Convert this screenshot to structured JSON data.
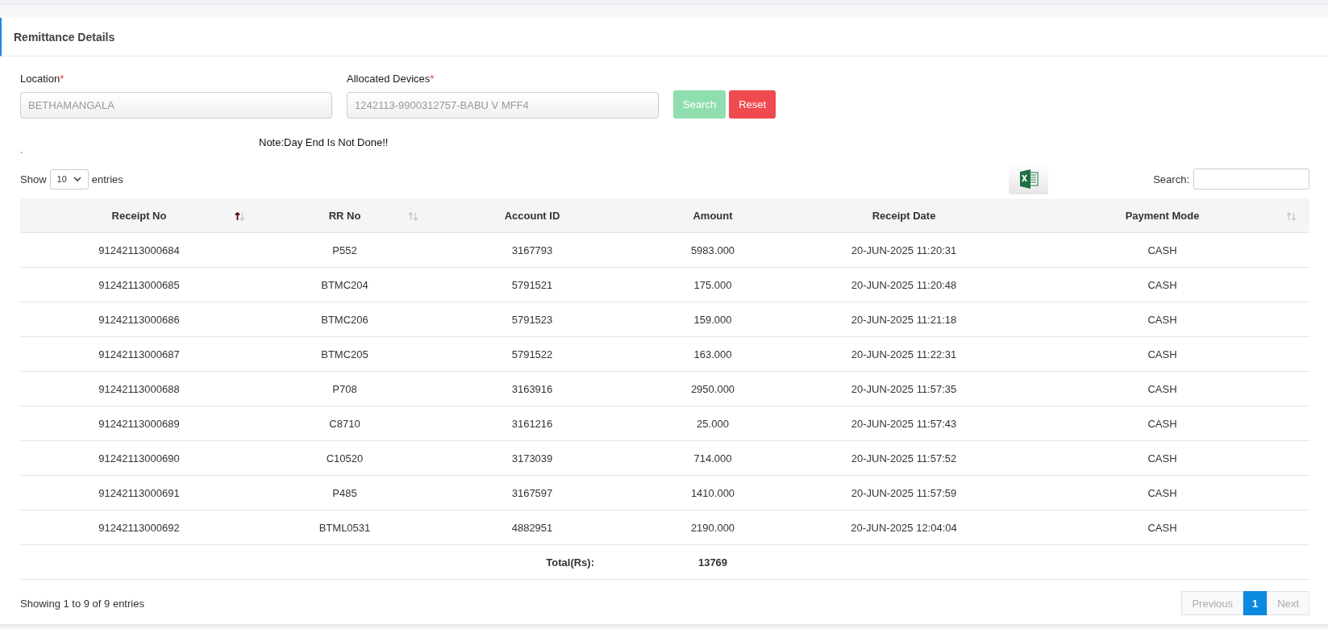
{
  "card": {
    "title": "Remittance Details"
  },
  "form": {
    "fields": [
      {
        "label": "Location",
        "required_mark": "*",
        "value": "BETHAMANGALA"
      },
      {
        "label": "Allocated Devices",
        "required_mark": "*",
        "value": "1242113-9900312757-BABU V MFF4"
      }
    ],
    "buttons": [
      {
        "label": "Search",
        "kind": "primary",
        "disabled": true
      },
      {
        "label": "Reset",
        "kind": "danger",
        "disabled": false
      }
    ],
    "note": "Note:Day End Is Not Done!!",
    "stray_mark": "`"
  },
  "table_controls": {
    "show_label": "Show",
    "page_size": "10",
    "entries_label": "entries",
    "search_label": "Search:"
  },
  "table": {
    "columns": [
      {
        "label": "Receipt No",
        "sortable": true,
        "sorted": true
      },
      {
        "label": "RR No",
        "sortable": true,
        "sorted": false
      },
      {
        "label": "Account ID",
        "sortable": false
      },
      {
        "label": "Amount",
        "sortable": false
      },
      {
        "label": "Receipt Date",
        "sortable": false
      },
      {
        "label": "Payment Mode",
        "sortable": true,
        "sorted": false
      }
    ],
    "rows": [
      [
        "91242113000684",
        "P552",
        "3167793",
        "5983.000",
        "20-JUN-2025 11:20:31",
        "CASH"
      ],
      [
        "91242113000685",
        "BTMC204",
        "5791521",
        "175.000",
        "20-JUN-2025 11:20:48",
        "CASH"
      ],
      [
        "91242113000686",
        "BTMC206",
        "5791523",
        "159.000",
        "20-JUN-2025 11:21:18",
        "CASH"
      ],
      [
        "91242113000687",
        "BTMC205",
        "5791522",
        "163.000",
        "20-JUN-2025 11:22:31",
        "CASH"
      ],
      [
        "91242113000688",
        "P708",
        "3163916",
        "2950.000",
        "20-JUN-2025 11:57:35",
        "CASH"
      ],
      [
        "91242113000689",
        "C8710",
        "3161216",
        "25.000",
        "20-JUN-2025 11:57:43",
        "CASH"
      ],
      [
        "91242113000690",
        "C10520",
        "3173039",
        "714.000",
        "20-JUN-2025 11:57:52",
        "CASH"
      ],
      [
        "91242113000691",
        "P485",
        "3167597",
        "1410.000",
        "20-JUN-2025 11:57:59",
        "CASH"
      ],
      [
        "91242113000692",
        "BTML0531",
        "4882951",
        "2190.000",
        "20-JUN-2025 12:04:04",
        "CASH"
      ]
    ],
    "total_label": "Total(Rs):",
    "total_value": "13769"
  },
  "footer": {
    "info": "Showing 1 to 9 of 9 entries",
    "pages": [
      {
        "label": "Previous",
        "kind": "nav",
        "disabled": true,
        "selected": false
      },
      {
        "label": "1",
        "kind": "page",
        "disabled": false,
        "selected": true
      },
      {
        "label": "Next",
        "kind": "nav",
        "disabled": true,
        "selected": false
      }
    ]
  }
}
